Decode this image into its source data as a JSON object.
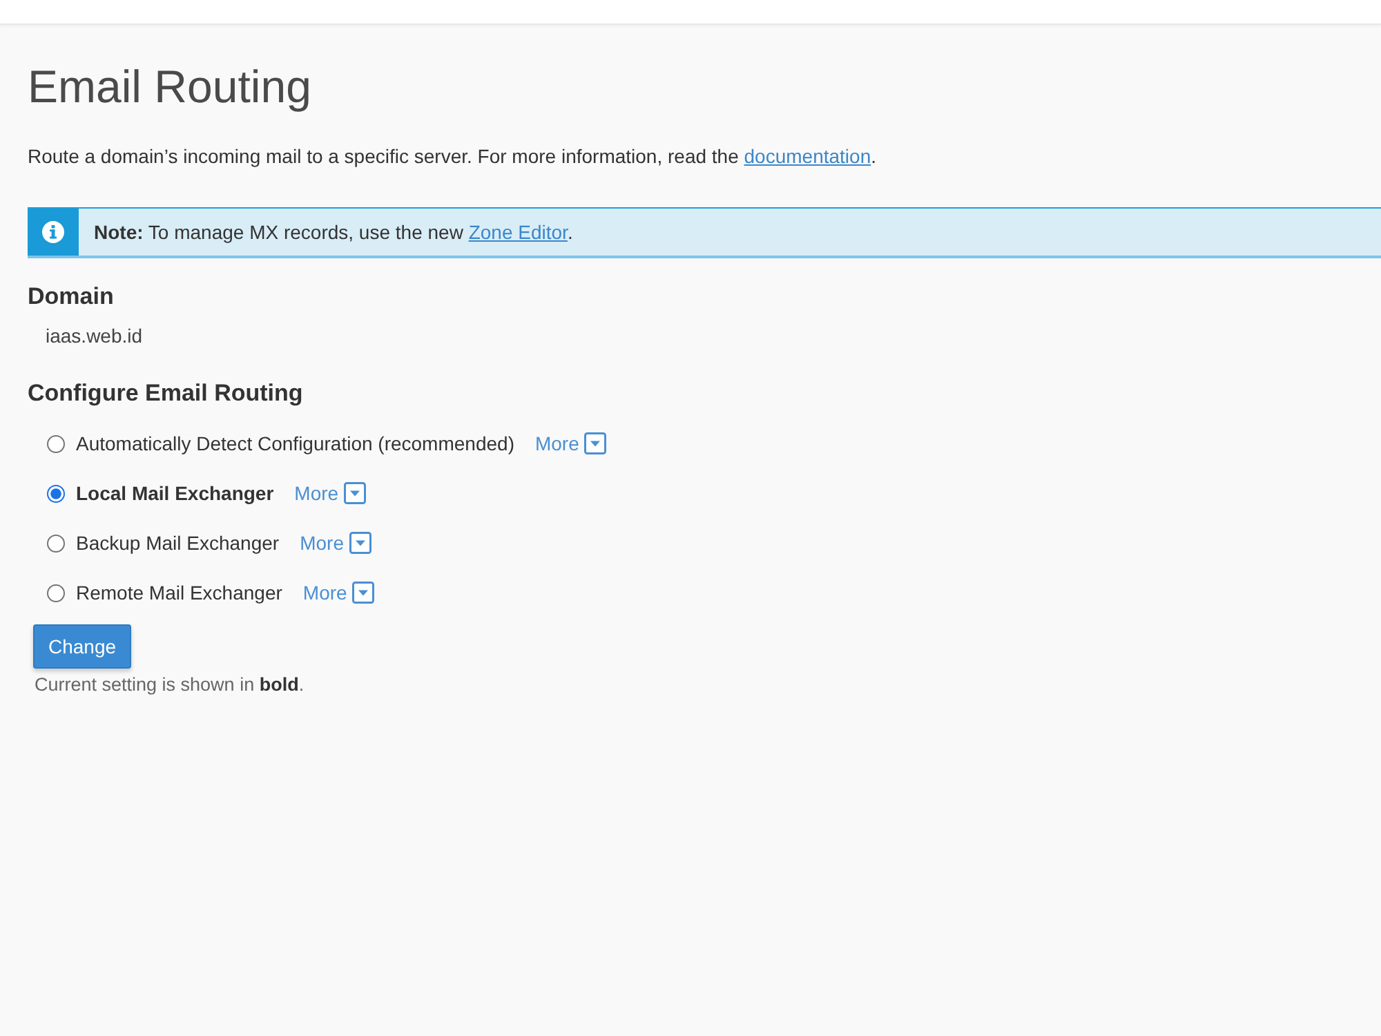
{
  "page": {
    "title": "Email Routing",
    "description": {
      "text": "Route a domain’s incoming mail to a specific server. For more information, read the ",
      "link": "documentation",
      "after": "."
    }
  },
  "note": {
    "label": "Note:",
    "text": " To manage MX records, use the new ",
    "link": "Zone Editor",
    "after": "."
  },
  "domain": {
    "heading": "Domain",
    "value": "iaas.web.id"
  },
  "routing": {
    "heading": "Configure Email Routing",
    "options": [
      {
        "label": "Automatically Detect Configuration (recommended)",
        "selected": false,
        "current": false,
        "more": "More"
      },
      {
        "label": "Local Mail Exchanger",
        "selected": true,
        "current": true,
        "more": "More"
      },
      {
        "label": "Backup Mail Exchanger",
        "selected": false,
        "current": false,
        "more": "More"
      },
      {
        "label": "Remote Mail Exchanger",
        "selected": false,
        "current": false,
        "more": "More"
      }
    ],
    "button": "Change",
    "footnote": "Current setting is shown in **bold**."
  }
}
